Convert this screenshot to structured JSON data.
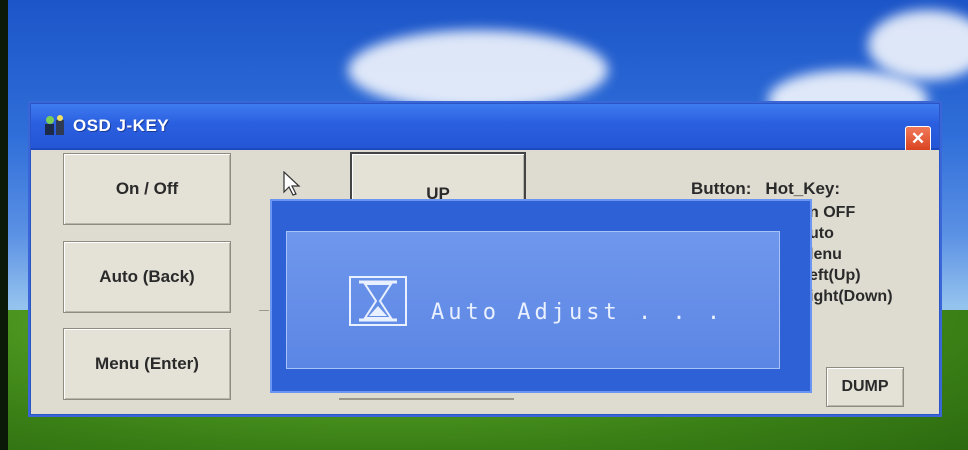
{
  "window": {
    "title": "OSD J-KEY",
    "close_symbol": "✕"
  },
  "buttons": {
    "on_off": "On / Off",
    "auto": "Auto (Back)",
    "menu": "Menu (Enter)",
    "up": "UP",
    "dump": "DUMP"
  },
  "legend": {
    "button_header": "Button:",
    "hotkey_header": "Hot_Key:",
    "items": [
      "n OFF",
      "uto",
      "lenu",
      "eft(Up)",
      "ight(Down)"
    ]
  },
  "osd": {
    "message": "Auto Adjust . . .",
    "icon": "hourglass-icon"
  },
  "colors": {
    "titlebar": "#2a5fe0",
    "osd_background": "#2f61d6",
    "osd_panel": "#6f97ec",
    "close_button": "#d9401e"
  }
}
